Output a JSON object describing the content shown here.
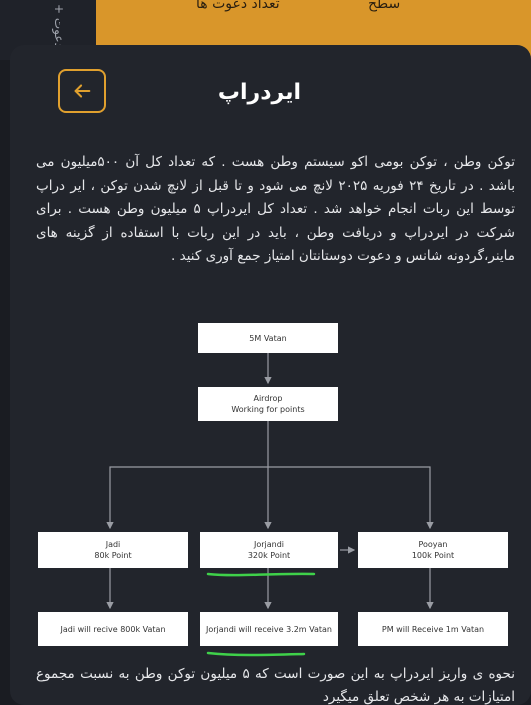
{
  "background": {
    "side_label": "+ دعوت",
    "level_label": "سطح",
    "invites_label": "تعداد دعوت ها"
  },
  "modal": {
    "title": "ایردراپ",
    "back_icon": "arrow-left-icon",
    "description": "توکن وطن ، توکن بومی اکو سیستم وطن هست . که تعداد کل آن ۵۰۰میلیون می باشد . در تاریخ ۲۴ فوریه ۲۰۲۵ لانچ می شود و تا قبل از لانچ شدن توکن ، ایر دراپ توسط این ربات انجام خواهد شد . تعداد کل ایردراپ ۵ میلیون وطن هست . برای شرکت در ایردراپ و دریافت وطن ، باید در این ربات با استفاده از گزینه های ماینر،گردونه شانس و دعوت دوستانتان امتیاز جمع آوری کنید .",
    "bottom_text": "نحوه ی واریز ایردراپ به این صورت است که ۵ میلیون توکن وطن به نسبت مجموع امتیازات به هر شخص تعلق میگیرد"
  },
  "flowchart": {
    "top": "5M Vatan",
    "airdrop_line1": "Airdrop",
    "airdrop_line2": "Working for points",
    "jadi_name": "Jadi",
    "jadi_points": "80k Point",
    "jorjandi_name": "Jorjandi",
    "jorjandi_points": "320k Point",
    "pooyan_name": "Pooyan",
    "pooyan_points": "100k Point",
    "jadi_receive": "Jadi will recive 800k Vatan",
    "jorjandi_receive": "Jorjandi will receive 3.2m Vatan",
    "pooyan_receive": "PM will Receive 1m Vatan"
  },
  "colors": {
    "accent": "#e0a02e",
    "background": "#1a1c22",
    "modal": "#22252c",
    "highlight": "#3fd14a"
  }
}
